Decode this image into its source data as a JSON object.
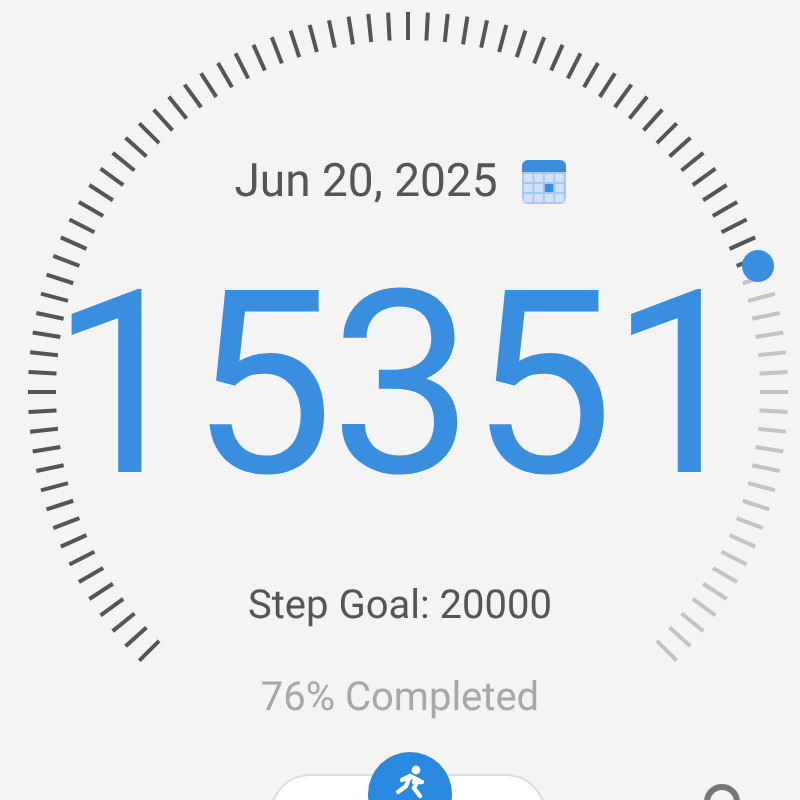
{
  "date": "Jun 20, 2025",
  "steps": "15351",
  "goal": "Step Goal: 20000",
  "completed": "76% Completed"
}
